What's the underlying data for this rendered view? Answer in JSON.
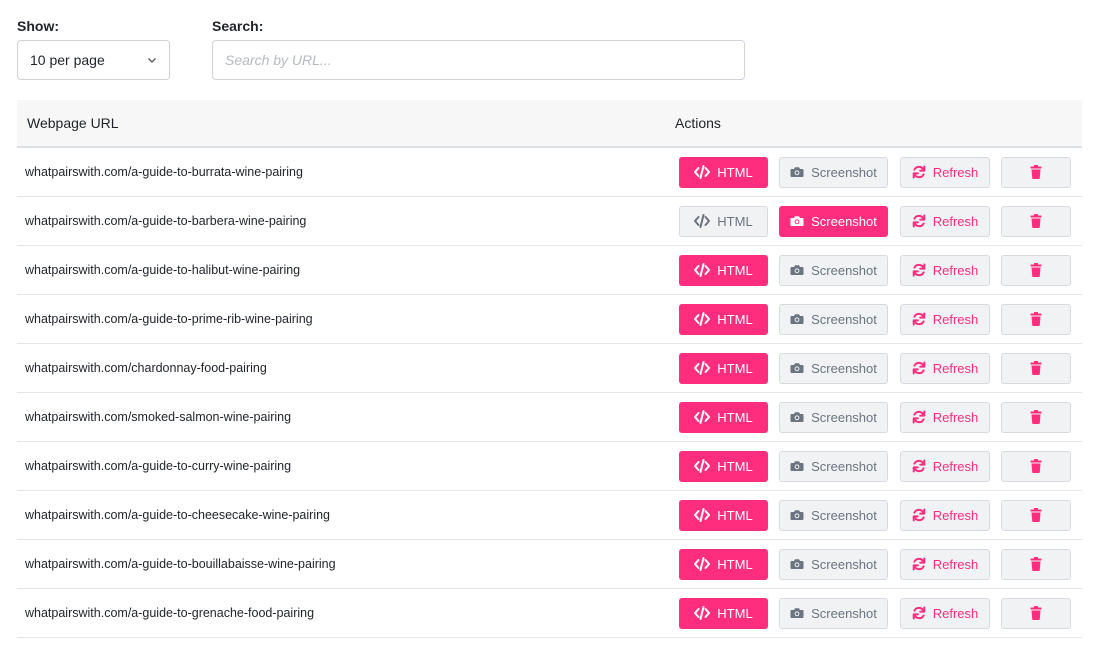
{
  "controls": {
    "show_label": "Show:",
    "show_value": "10 per page",
    "search_label": "Search:",
    "search_placeholder": "Search by URL...",
    "search_value": ""
  },
  "table": {
    "headers": {
      "url": "Webpage URL",
      "actions": "Actions"
    },
    "action_labels": {
      "html": "HTML",
      "screenshot": "Screenshot",
      "refresh": "Refresh"
    },
    "rows": [
      {
        "url": "whatpairswith.com/a-guide-to-burrata-wine-pairing",
        "active": "html"
      },
      {
        "url": "whatpairswith.com/a-guide-to-barbera-wine-pairing",
        "active": "screenshot"
      },
      {
        "url": "whatpairswith.com/a-guide-to-halibut-wine-pairing",
        "active": "html"
      },
      {
        "url": "whatpairswith.com/a-guide-to-prime-rib-wine-pairing",
        "active": "html"
      },
      {
        "url": "whatpairswith.com/chardonnay-food-pairing",
        "active": "html"
      },
      {
        "url": "whatpairswith.com/smoked-salmon-wine-pairing",
        "active": "html"
      },
      {
        "url": "whatpairswith.com/a-guide-to-curry-wine-pairing",
        "active": "html"
      },
      {
        "url": "whatpairswith.com/a-guide-to-cheesecake-wine-pairing",
        "active": "html"
      },
      {
        "url": "whatpairswith.com/a-guide-to-bouillabaisse-wine-pairing",
        "active": "html"
      },
      {
        "url": "whatpairswith.com/a-guide-to-grenache-food-pairing",
        "active": "html"
      }
    ]
  },
  "colors": {
    "accent": "#ff2d7d",
    "muted_text": "#6b7480",
    "button_bg": "#f1f2f4"
  },
  "icons": {
    "html": "code-icon",
    "screenshot": "camera-icon",
    "refresh": "refresh-icon",
    "delete": "trash-icon",
    "select": "chevron-down-icon"
  }
}
